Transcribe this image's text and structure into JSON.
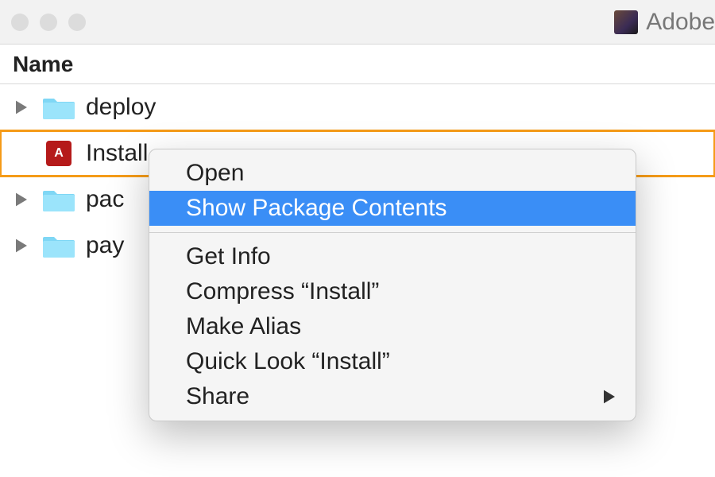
{
  "titlebar": {
    "window_title_partial": "Adobe"
  },
  "columns": {
    "name_header": "Name"
  },
  "rows": [
    {
      "name": "deploy",
      "type": "folder",
      "expandable": true,
      "selected": false
    },
    {
      "name": "Install",
      "type": "app",
      "expandable": false,
      "selected": true
    },
    {
      "name": "packages",
      "name_visible": "pac",
      "type": "folder",
      "expandable": true,
      "selected": false
    },
    {
      "name": "payloads",
      "name_visible": "pay",
      "type": "folder",
      "expandable": true,
      "selected": false
    }
  ],
  "context_menu": {
    "items": [
      {
        "label": "Open"
      },
      {
        "label": "Show Package Contents",
        "highlighted": true
      }
    ],
    "items2": [
      {
        "label": "Get Info"
      },
      {
        "label": "Compress “Install”"
      },
      {
        "label": "Make Alias"
      },
      {
        "label": "Quick Look “Install”"
      },
      {
        "label": "Share",
        "submenu": true
      }
    ]
  }
}
